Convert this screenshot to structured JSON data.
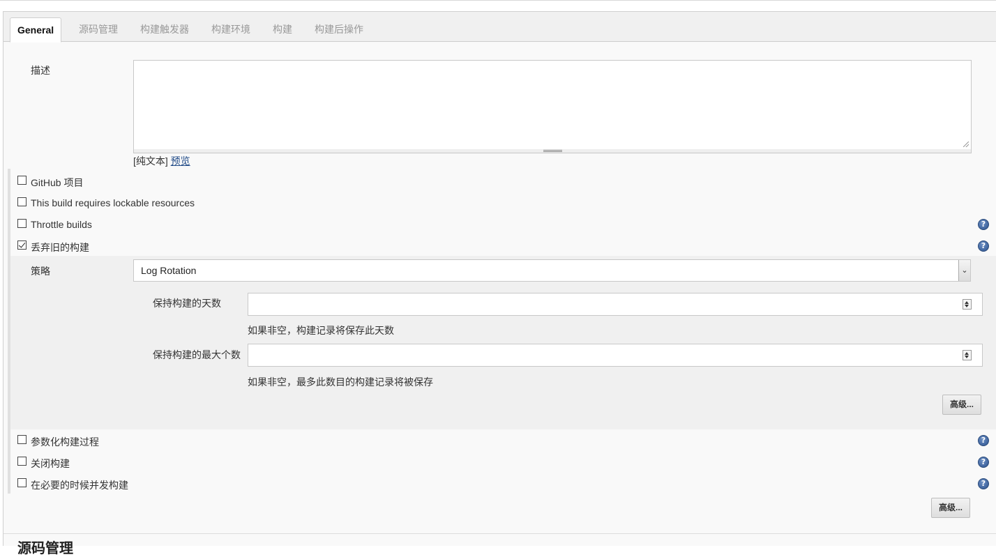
{
  "tabs": [
    "General",
    "源码管理",
    "构建触发器",
    "构建环境",
    "构建",
    "构建后操作"
  ],
  "description": {
    "label": "描述",
    "value": "",
    "format_prefix": "[纯文本]",
    "preview_link": "预览"
  },
  "options": {
    "github": "GitHub 项目",
    "lockable": "This build requires lockable resources",
    "throttle": "Throttle builds",
    "discard": "丢弃旧的构建",
    "parameterized": "参数化构建过程",
    "disable": "关闭构建",
    "concurrent": "在必要的时候并发构建"
  },
  "strategy": {
    "label": "策略",
    "selected": "Log Rotation",
    "days_label": "保持构建的天数",
    "days_value": "",
    "days_hint": "如果非空，构建记录将保存此天数",
    "max_label": "保持构建的最大个数",
    "max_value": "",
    "max_hint": "如果非空，最多此数目的构建记录将被保存",
    "advanced_button": "高级..."
  },
  "advanced_button": "高级...",
  "next_section_title": "源码管理",
  "icons": {
    "help": "help-icon",
    "checkbox_checked": "checkbox-checked-icon"
  },
  "colors": {
    "help_icon": "#2e548f",
    "link": "#204a87"
  }
}
